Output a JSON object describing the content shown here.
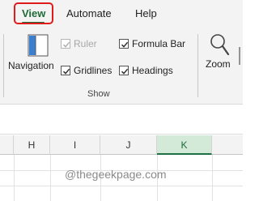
{
  "ribbon_tabs": {
    "view": "View",
    "automate": "Automate",
    "help": "Help"
  },
  "show_group": {
    "navigation_label": "Navigation",
    "ruler": {
      "label": "Ruler",
      "checked": true,
      "enabled": false
    },
    "gridlines": {
      "label": "Gridlines",
      "checked": true,
      "enabled": true
    },
    "formula_bar": {
      "label": "Formula Bar",
      "checked": true,
      "enabled": true
    },
    "headings": {
      "label": "Headings",
      "checked": true,
      "enabled": true
    },
    "group_label": "Show"
  },
  "zoom_group": {
    "zoom_label": "Zoom"
  },
  "columns": [
    "H",
    "I",
    "J",
    "K"
  ],
  "selected_column": "K",
  "watermark": "@thegeekpage.com",
  "colors": {
    "accent_green": "#1e6b39",
    "highlight_red": "#e01b1b",
    "selected_header_bg": "#d3ead9"
  }
}
